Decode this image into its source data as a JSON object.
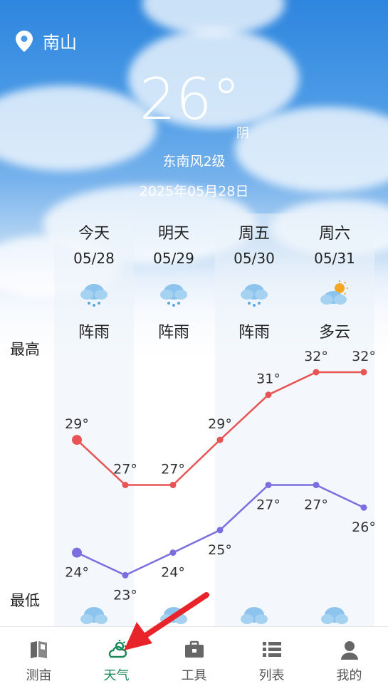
{
  "location": "南山",
  "current": {
    "temp": "26°",
    "condition": "阴",
    "wind": "东南风2级",
    "date": "2025年05月28日"
  },
  "side_labels": {
    "high": "最高",
    "low": "最低"
  },
  "days": [
    {
      "label": "今天",
      "date": "05/28",
      "condition": "阵雨",
      "icon": "shower-cloud-icon"
    },
    {
      "label": "明天",
      "date": "05/29",
      "condition": "阵雨",
      "icon": "shower-cloud-icon"
    },
    {
      "label": "周五",
      "date": "05/30",
      "condition": "阵雨",
      "icon": "shower-cloud-icon"
    },
    {
      "label": "周六",
      "date": "05/31",
      "condition": "多云",
      "icon": "partly-cloudy-icon"
    }
  ],
  "chart_data": {
    "type": "line",
    "series": [
      {
        "values": [
          29,
          27,
          27,
          29,
          31,
          32,
          32
        ],
        "labels": [
          "29°",
          "27°",
          "27°",
          "29°",
          "31°",
          "32°",
          "32°"
        ],
        "color": "#e85454"
      },
      {
        "values": [
          24,
          23,
          24,
          25,
          27,
          27,
          26
        ],
        "labels": [
          "24°",
          "23°",
          "24°",
          "25°",
          "27°",
          "27°",
          "26°"
        ],
        "color": "#7b6fe0"
      }
    ]
  },
  "nav": {
    "items": [
      {
        "label": "测亩",
        "icon": "map-icon",
        "active": false
      },
      {
        "label": "天气",
        "icon": "weather-icon",
        "active": true
      },
      {
        "label": "工具",
        "icon": "toolbox-icon",
        "active": false
      },
      {
        "label": "列表",
        "icon": "list-icon",
        "active": false
      },
      {
        "label": "我的",
        "icon": "profile-icon",
        "active": false
      }
    ],
    "active_color": "#1b8a5a"
  }
}
